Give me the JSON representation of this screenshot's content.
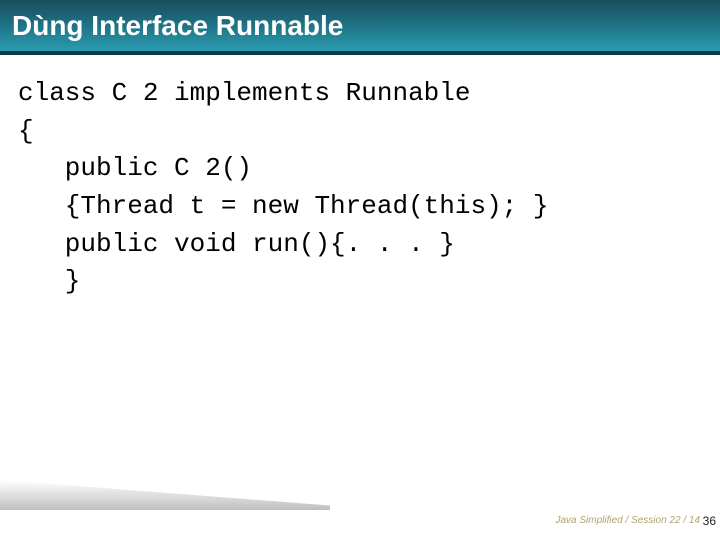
{
  "header": {
    "title": "Dùng Interface Runnable"
  },
  "code": {
    "line1": "class C 2 implements Runnable",
    "line2": "{",
    "line3": "   public C 2()",
    "line4": "   {Thread t = new Thread(this); }",
    "line5": "   public void run(){. . . }",
    "line6": "   }"
  },
  "footer": {
    "credit": "Java Simplified / Session 22 / 14",
    "page": "36"
  }
}
